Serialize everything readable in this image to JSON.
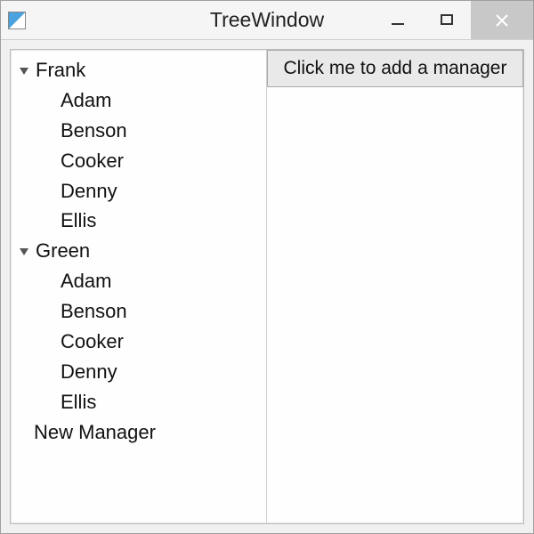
{
  "window": {
    "title": "TreeWindow"
  },
  "tree": {
    "roots": [
      {
        "label": "Frank",
        "expanded": true,
        "children": [
          "Adam",
          "Benson",
          "Cooker",
          "Denny",
          "Ellis"
        ]
      },
      {
        "label": "Green",
        "expanded": true,
        "children": [
          "Adam",
          "Benson",
          "Cooker",
          "Denny",
          "Ellis"
        ]
      }
    ],
    "extra_item": "New Manager"
  },
  "button": {
    "add_manager_label": "Click me to add a manager"
  }
}
